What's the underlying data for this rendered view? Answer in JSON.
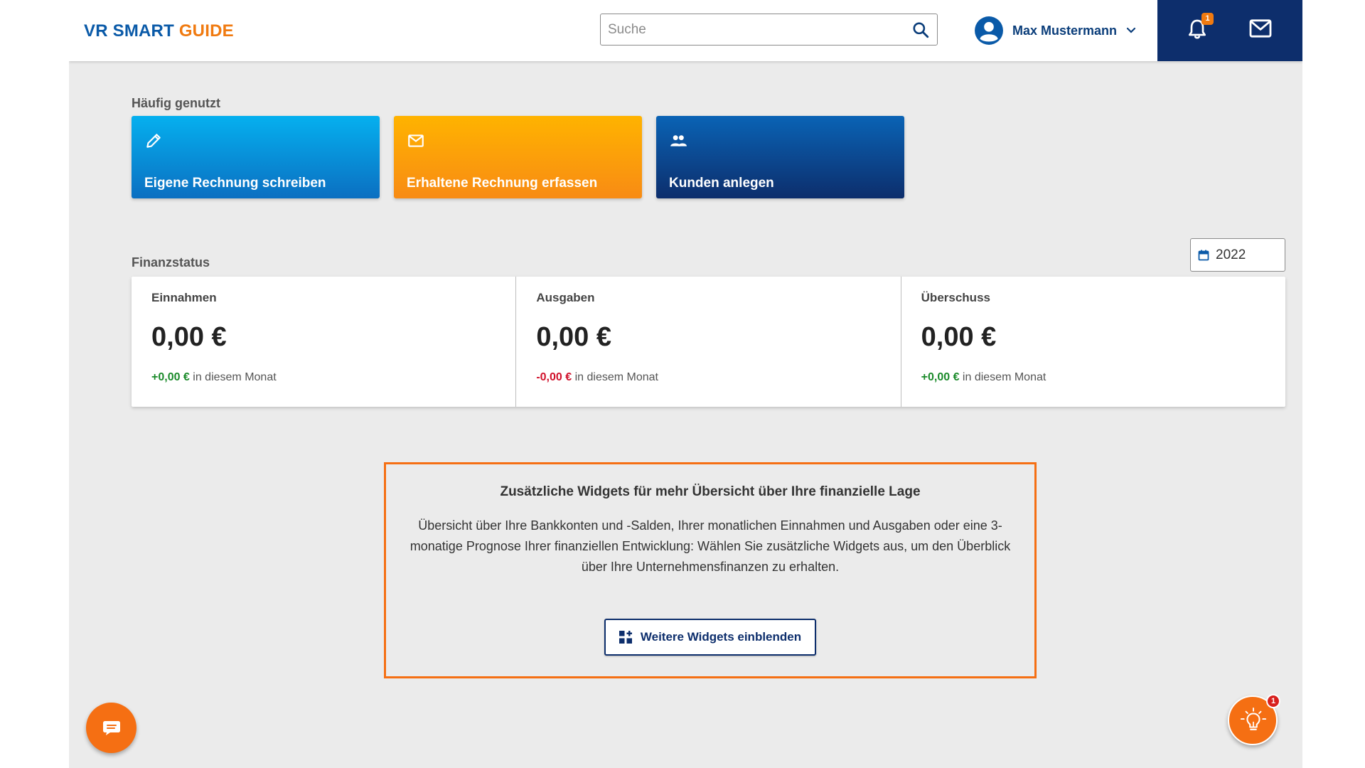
{
  "header": {
    "logo_part1": "VR SMART ",
    "logo_part2": "GUIDE",
    "search_placeholder": "Suche",
    "user_name": "Max Mustermann",
    "notification_count": "1"
  },
  "frequently_used": {
    "label": "Häufig genutzt",
    "tiles": [
      {
        "label": "Eigene Rechnung schreiben",
        "icon": "pencil-icon"
      },
      {
        "label": "Erhaltene Rechnung erfassen",
        "icon": "envelope-icon"
      },
      {
        "label": "Kunden anlegen",
        "icon": "people-icon"
      }
    ]
  },
  "finance": {
    "label": "Finanzstatus",
    "year": "2022",
    "columns": [
      {
        "title": "Einnahmen",
        "amount": "0,00 €",
        "delta": "+0,00 €",
        "delta_type": "positive",
        "suffix": " in diesem Monat"
      },
      {
        "title": "Ausgaben",
        "amount": "0,00 €",
        "delta": "-0,00 €",
        "delta_type": "negative",
        "suffix": " in diesem Monat"
      },
      {
        "title": "Überschuss",
        "amount": "0,00 €",
        "delta": "+0,00 €",
        "delta_type": "positive",
        "suffix": " in diesem Monat"
      }
    ]
  },
  "promo": {
    "title": "Zusätzliche Widgets für mehr Übersicht über Ihre finanzielle Lage",
    "text": "Übersicht über Ihre Bankkonten und -Salden, Ihrer monatlichen Einnahmen und Ausgaben oder eine 3-monatige Prognose Ihrer finanziellen Entwicklung: Wählen Sie zusätzliche Widgets aus, um den Überblick über Ihre Unternehmensfinanzen zu erhalten.",
    "button_label": "Weitere Widgets einblenden"
  },
  "floating": {
    "idea_badge": "1"
  },
  "colors": {
    "brand_blue": "#0a5aa8",
    "brand_orange": "#f07a10",
    "navy": "#0d2e6c",
    "positive": "#1a8a2a",
    "negative": "#d0102a"
  }
}
